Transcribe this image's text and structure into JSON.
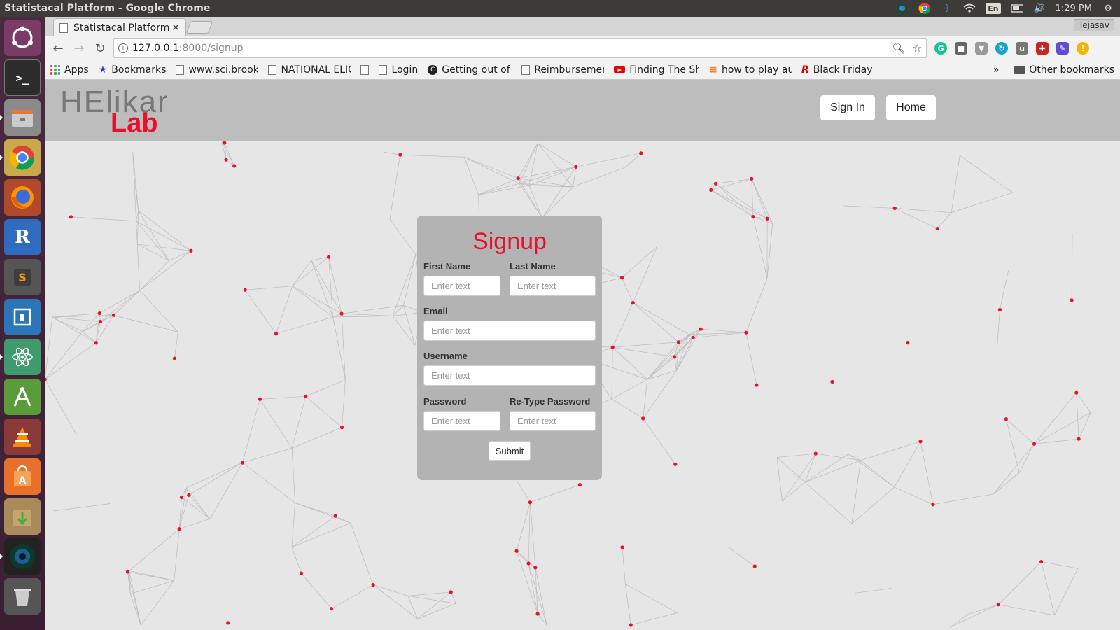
{
  "system": {
    "window_title": "Statistacal Platform - Google Chrome",
    "language": "En",
    "clock": "1:29 PM"
  },
  "launcher": {
    "items": [
      "ubuntu-dash",
      "terminal",
      "files",
      "chrome",
      "firefox",
      "r",
      "sublime",
      "window-tool",
      "atom",
      "android-studio",
      "vlc",
      "software-center",
      "archive",
      "camera",
      "trash"
    ]
  },
  "browser": {
    "tab_title": "Statistacal Platform",
    "profile": "Tejasav",
    "url_host": "127.0.0.1",
    "url_path": ":8000/signup",
    "bookmarks": [
      {
        "label": "Apps"
      },
      {
        "label": "Bookmarks"
      },
      {
        "label": "www.sci.brookl"
      },
      {
        "label": "NATIONAL ELIG"
      },
      {
        "label": ""
      },
      {
        "label": "Login"
      },
      {
        "label": "Getting out of y"
      },
      {
        "label": "Reimbursement"
      },
      {
        "label": "Finding The Shu"
      },
      {
        "label": "how to play aud"
      },
      {
        "label": "Black Friday"
      }
    ],
    "more": "»",
    "other_bookmarks": "Other bookmarks"
  },
  "site": {
    "logo_top": "HElikar",
    "logo_bottom": "Lab",
    "nav": {
      "signin": "Sign In",
      "home": "Home"
    },
    "colors": {
      "accent": "#e8112d",
      "header_bg": "#bdbdbd",
      "card_bg": "#b3b3b3"
    }
  },
  "form": {
    "title": "Signup",
    "first_name_label": "First Name",
    "last_name_label": "Last Name",
    "email_label": "Email",
    "username_label": "Username",
    "password_label": "Password",
    "retype_label": "Re-Type Password",
    "placeholder": "Enter text",
    "submit": "Submit"
  }
}
